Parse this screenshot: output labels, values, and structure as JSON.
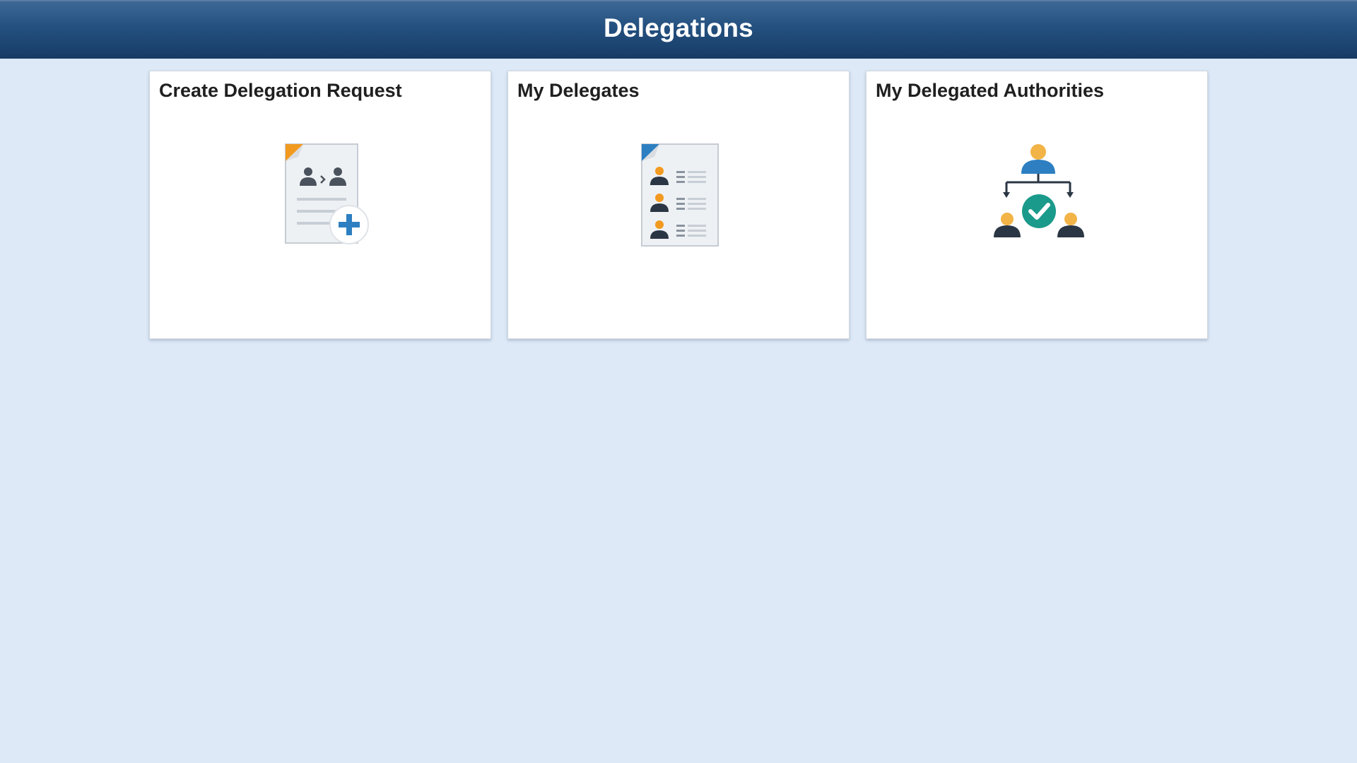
{
  "header": {
    "title": "Delegations"
  },
  "tiles": [
    {
      "label": "Create Delegation Request",
      "icon": "create-delegation-request-icon"
    },
    {
      "label": "My Delegates",
      "icon": "my-delegates-icon"
    },
    {
      "label": "My Delegated Authorities",
      "icon": "delegated-authorities-icon"
    }
  ],
  "colors": {
    "header_top": "#3d6896",
    "header_bottom": "#173c66",
    "background": "#dde9f7",
    "tile_background": "#ffffff",
    "accent_orange": "#f29a1f",
    "accent_blue": "#2d7fc1",
    "accent_teal": "#1a9a8a",
    "person_dark": "#2b3644"
  }
}
